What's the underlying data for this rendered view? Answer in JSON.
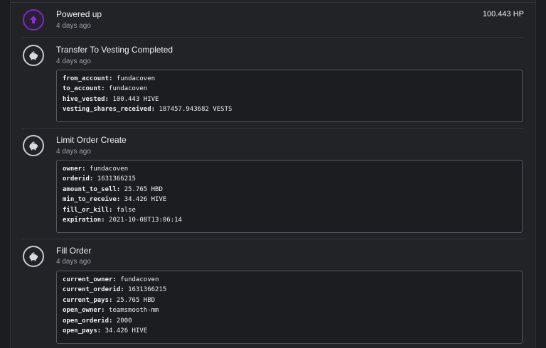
{
  "events": [
    {
      "title": "Powered up",
      "time": "4 days ago",
      "amount": "100.443 HP",
      "icon": "power-up-arrow-icon",
      "accent": "#7a2bb8"
    },
    {
      "title": "Transfer To Vesting Completed",
      "time": "4 days ago",
      "icon": "piggy-bank-icon",
      "fields": [
        {
          "key": "from_account:",
          "value": " fundacoven"
        },
        {
          "key": "to_account:",
          "value": " fundacoven"
        },
        {
          "key": "hive_vested:",
          "value": " 100.443 HIVE"
        },
        {
          "key": "vesting_shares_received:",
          "value": " 187457.943682 VESTS"
        }
      ]
    },
    {
      "title": "Limit Order Create",
      "time": "4 days ago",
      "icon": "piggy-bank-icon",
      "fields": [
        {
          "key": "owner:",
          "value": " fundacoven"
        },
        {
          "key": "orderid:",
          "value": " 1631366215"
        },
        {
          "key": "amount_to_sell:",
          "value": " 25.765 HBD"
        },
        {
          "key": "min_to_receive:",
          "value": " 34.426 HIVE"
        },
        {
          "key": "fill_or_kill:",
          "value": " false"
        },
        {
          "key": "expiration:",
          "value": " 2021-10-08T13:06:14"
        }
      ]
    },
    {
      "title": "Fill Order",
      "time": "4 days ago",
      "icon": "piggy-bank-icon",
      "fields": [
        {
          "key": "current_owner:",
          "value": " fundacoven"
        },
        {
          "key": "current_orderid:",
          "value": " 1631366215"
        },
        {
          "key": "current_pays:",
          "value": " 25.765 HBD"
        },
        {
          "key": "open_owner:",
          "value": " teamsmooth-mm"
        },
        {
          "key": "open_orderid:",
          "value": " 2000"
        },
        {
          "key": "open_pays:",
          "value": " 34.426 HIVE"
        }
      ]
    }
  ]
}
